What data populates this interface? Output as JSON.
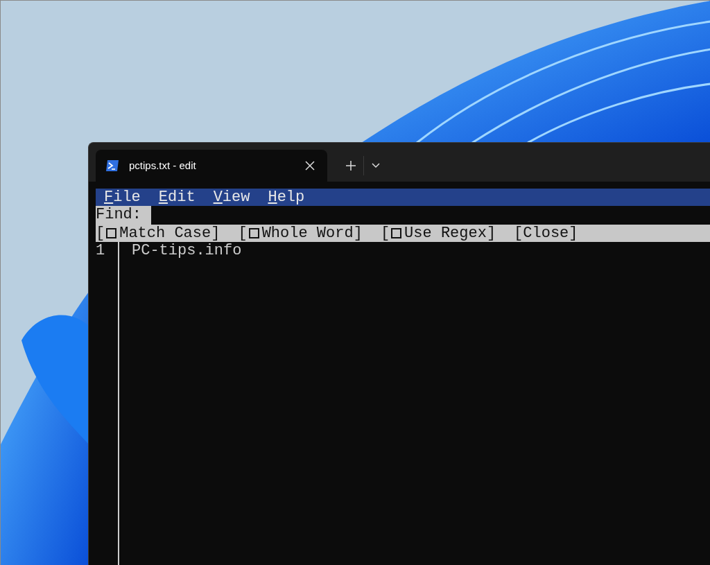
{
  "window": {
    "tab": {
      "title": "pctips.txt - edit",
      "selected": true
    }
  },
  "menu": [
    {
      "label": "File"
    },
    {
      "label": "Edit"
    },
    {
      "label": "View"
    },
    {
      "label": "Help"
    }
  ],
  "find": {
    "label": "Find:"
  },
  "options": [
    {
      "kind": "checkbox",
      "open": "[",
      "label": "Match Case",
      "close": "]",
      "checked": false
    },
    {
      "kind": "checkbox",
      "open": "[",
      "label": "Whole Word",
      "close": "]",
      "checked": false
    },
    {
      "kind": "checkbox",
      "open": "[",
      "label": "Use Regex",
      "close": "]",
      "checked": false
    },
    {
      "kind": "button",
      "label": "[Close]"
    }
  ],
  "editor": {
    "lines": [
      {
        "number": "1",
        "text": "PC-tips.info"
      }
    ]
  }
}
